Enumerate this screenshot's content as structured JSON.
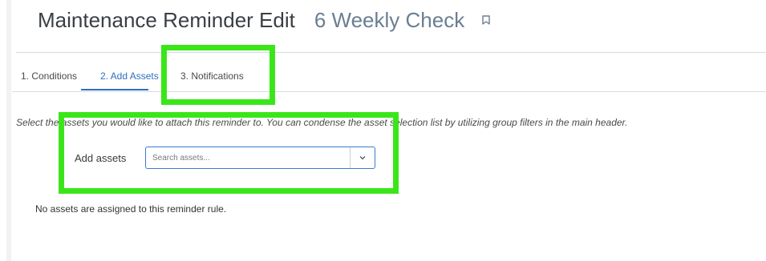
{
  "header": {
    "title": "Maintenance Reminder Edit",
    "subtitle": "6 Weekly Check"
  },
  "tabs": [
    {
      "label": "1. Conditions",
      "active": false
    },
    {
      "label": "2. Add Assets",
      "active": true
    },
    {
      "label": "3. Notifications",
      "active": false
    }
  ],
  "main": {
    "instruction": "Select the assets you would like to attach this reminder to. You can condense the asset selection list by utilizing group filters in the main header.",
    "add_assets_label": "Add assets",
    "search_placeholder": "Search assets...",
    "empty_message": "No assets are assigned to this reminder rule."
  },
  "colors": {
    "accent": "#2f6fbf",
    "highlight": "#3ae61a"
  },
  "icons": {
    "bookmark": "bookmark-icon",
    "dropdown": "chevron-down-icon"
  }
}
